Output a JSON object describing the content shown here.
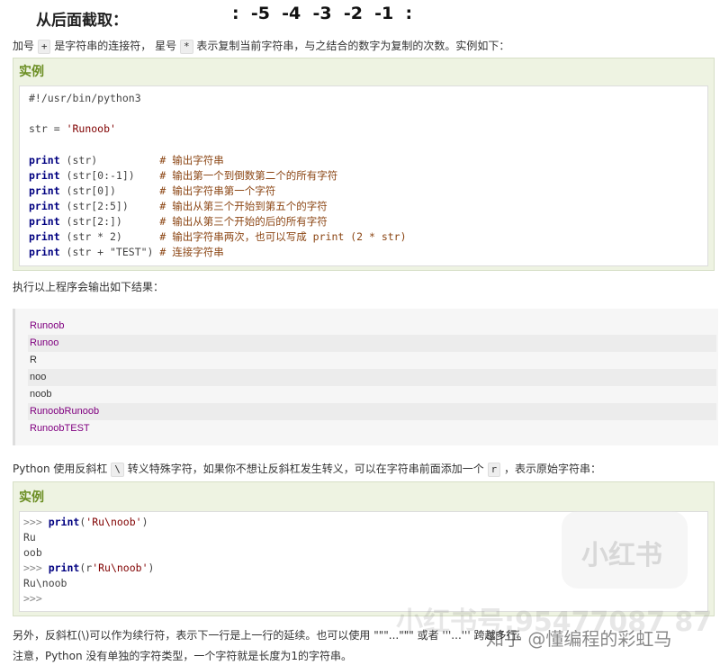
{
  "top": {
    "heading": "从后面截取：",
    "indices": ":  -5  -4  -3  -2  -1  :"
  },
  "intro": {
    "part1": "加号",
    "plus": "+",
    "part2": "是字符串的连接符， 星号",
    "star": "*",
    "part3": "表示复制当前字符串，与之结合的数字为复制的次数。实例如下："
  },
  "example1": {
    "title": "实例",
    "shebang": "#!/usr/bin/python3",
    "assign_var": "str",
    "assign_eq": " = ",
    "assign_val": "'Runoob'",
    "lines": [
      {
        "kw": "print",
        "arg": " (str)          ",
        "comment": "# 输出字符串"
      },
      {
        "kw": "print",
        "arg": " (str[0:-1])    ",
        "comment": "# 输出第一个到倒数第二个的所有字符"
      },
      {
        "kw": "print",
        "arg": " (str[0])       ",
        "comment": "# 输出字符串第一个字符"
      },
      {
        "kw": "print",
        "arg": " (str[2:5])     ",
        "comment": "# 输出从第三个开始到第五个的字符"
      },
      {
        "kw": "print",
        "arg": " (str[2:])      ",
        "comment": "# 输出从第三个开始的后的所有字符"
      },
      {
        "kw": "print",
        "arg": " (str * 2)      ",
        "comment": "# 输出字符串两次，也可以写成 print (2 * str)"
      },
      {
        "kw": "print",
        "arg": " (str + \"TEST\") ",
        "comment": "# 连接字符串"
      }
    ]
  },
  "output_intro": "执行以上程序会输出如下结果：",
  "output_lines": [
    "Runoob",
    "Runoo",
    "R",
    "noo",
    "noob",
    "RunoobRunoob",
    "RunoobTEST"
  ],
  "escape_note": {
    "part1": "Python 使用反斜杠",
    "backslash": "\\",
    "part2": "转义特殊字符，如果你不想让反斜杠发生转义，可以在字符串前面添加一个",
    "r": "r",
    "part3": "，表示原始字符串："
  },
  "example2": {
    "title": "实例",
    "line1_prompt": ">>> ",
    "line1_kw": "print",
    "line1_a": "(",
    "line1_b": "'Ru\\noob'",
    "line1_c": ")",
    "line2": "Ru",
    "line3": "oob",
    "line4_prompt": ">>> ",
    "line4_kw": "print",
    "line4_a": "(r",
    "line4_b": "'Ru\\noob'",
    "line4_c": ")",
    "line5": "Ru\\noob",
    "line6": ">>>"
  },
  "bottom": {
    "line1": "另外，反斜杠(\\)可以作为续行符，表示下一行是上一行的延续。也可以使用 \"\"\"...\"\"\" 或者 '''...''' 跨越多行。",
    "line2": "注意，Python 没有单独的字符类型，一个字符就是长度为1的字符串。"
  },
  "watermarks": {
    "overlay": "小红书号:95477087 87",
    "logo": "小红书",
    "credit": "知乎 @懂编程的彩虹马"
  }
}
